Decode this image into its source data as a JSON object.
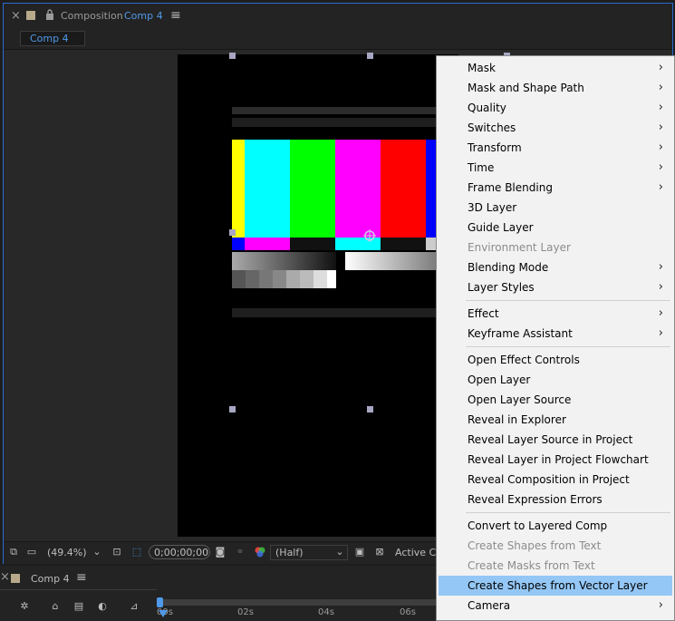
{
  "panel": {
    "close_glyph": "×",
    "title_prefix": "Composition",
    "comp_name": "Comp 4",
    "menu_glyph": "≡",
    "tab_label": "Comp 4"
  },
  "toolbar": {
    "zoom": "(49.4%)",
    "timecode": "0;00;00;00",
    "resolution": "(Half)",
    "active_camera": "Active Ca"
  },
  "timeline": {
    "close_glyph": "×",
    "tab_label": "Comp 4",
    "menu_glyph": "≡",
    "ruler_labels": [
      "00s",
      "02s",
      "04s",
      "06s"
    ]
  },
  "context_menu": {
    "items": [
      {
        "label": "Mask",
        "submenu": true,
        "enabled": true
      },
      {
        "label": "Mask and Shape Path",
        "submenu": true,
        "enabled": true
      },
      {
        "label": "Quality",
        "submenu": true,
        "enabled": true
      },
      {
        "label": "Switches",
        "submenu": true,
        "enabled": true
      },
      {
        "label": "Transform",
        "submenu": true,
        "enabled": true
      },
      {
        "label": "Time",
        "submenu": true,
        "enabled": true
      },
      {
        "label": "Frame Blending",
        "submenu": true,
        "enabled": true
      },
      {
        "label": "3D Layer",
        "submenu": false,
        "enabled": true
      },
      {
        "label": "Guide Layer",
        "submenu": false,
        "enabled": true
      },
      {
        "label": "Environment Layer",
        "submenu": false,
        "enabled": false
      },
      {
        "label": "Blending Mode",
        "submenu": true,
        "enabled": true
      },
      {
        "label": "Layer Styles",
        "submenu": true,
        "enabled": true
      },
      {
        "separator": true
      },
      {
        "label": "Effect",
        "submenu": true,
        "enabled": true
      },
      {
        "label": "Keyframe Assistant",
        "submenu": true,
        "enabled": true
      },
      {
        "separator": true
      },
      {
        "label": "Open Effect Controls",
        "submenu": false,
        "enabled": true
      },
      {
        "label": "Open Layer",
        "submenu": false,
        "enabled": true
      },
      {
        "label": "Open Layer Source",
        "submenu": false,
        "enabled": true
      },
      {
        "label": "Reveal in Explorer",
        "submenu": false,
        "enabled": true
      },
      {
        "label": "Reveal Layer Source in Project",
        "submenu": false,
        "enabled": true
      },
      {
        "label": "Reveal Layer in Project Flowchart",
        "submenu": false,
        "enabled": true
      },
      {
        "label": "Reveal Composition in Project",
        "submenu": false,
        "enabled": true
      },
      {
        "label": "Reveal Expression Errors",
        "submenu": false,
        "enabled": true
      },
      {
        "separator": true
      },
      {
        "label": "Convert to Layered Comp",
        "submenu": false,
        "enabled": true
      },
      {
        "label": "Create Shapes from Text",
        "submenu": false,
        "enabled": false
      },
      {
        "label": "Create Masks from Text",
        "submenu": false,
        "enabled": false
      },
      {
        "label": "Create Shapes from Vector Layer",
        "submenu": false,
        "enabled": true,
        "highlighted": true
      },
      {
        "label": "Camera",
        "submenu": true,
        "enabled": true
      }
    ]
  },
  "colors": {
    "accent": "#4f9ae8",
    "menu_highlight": "#94c7f5",
    "panel_border": "#2b6cd0"
  }
}
